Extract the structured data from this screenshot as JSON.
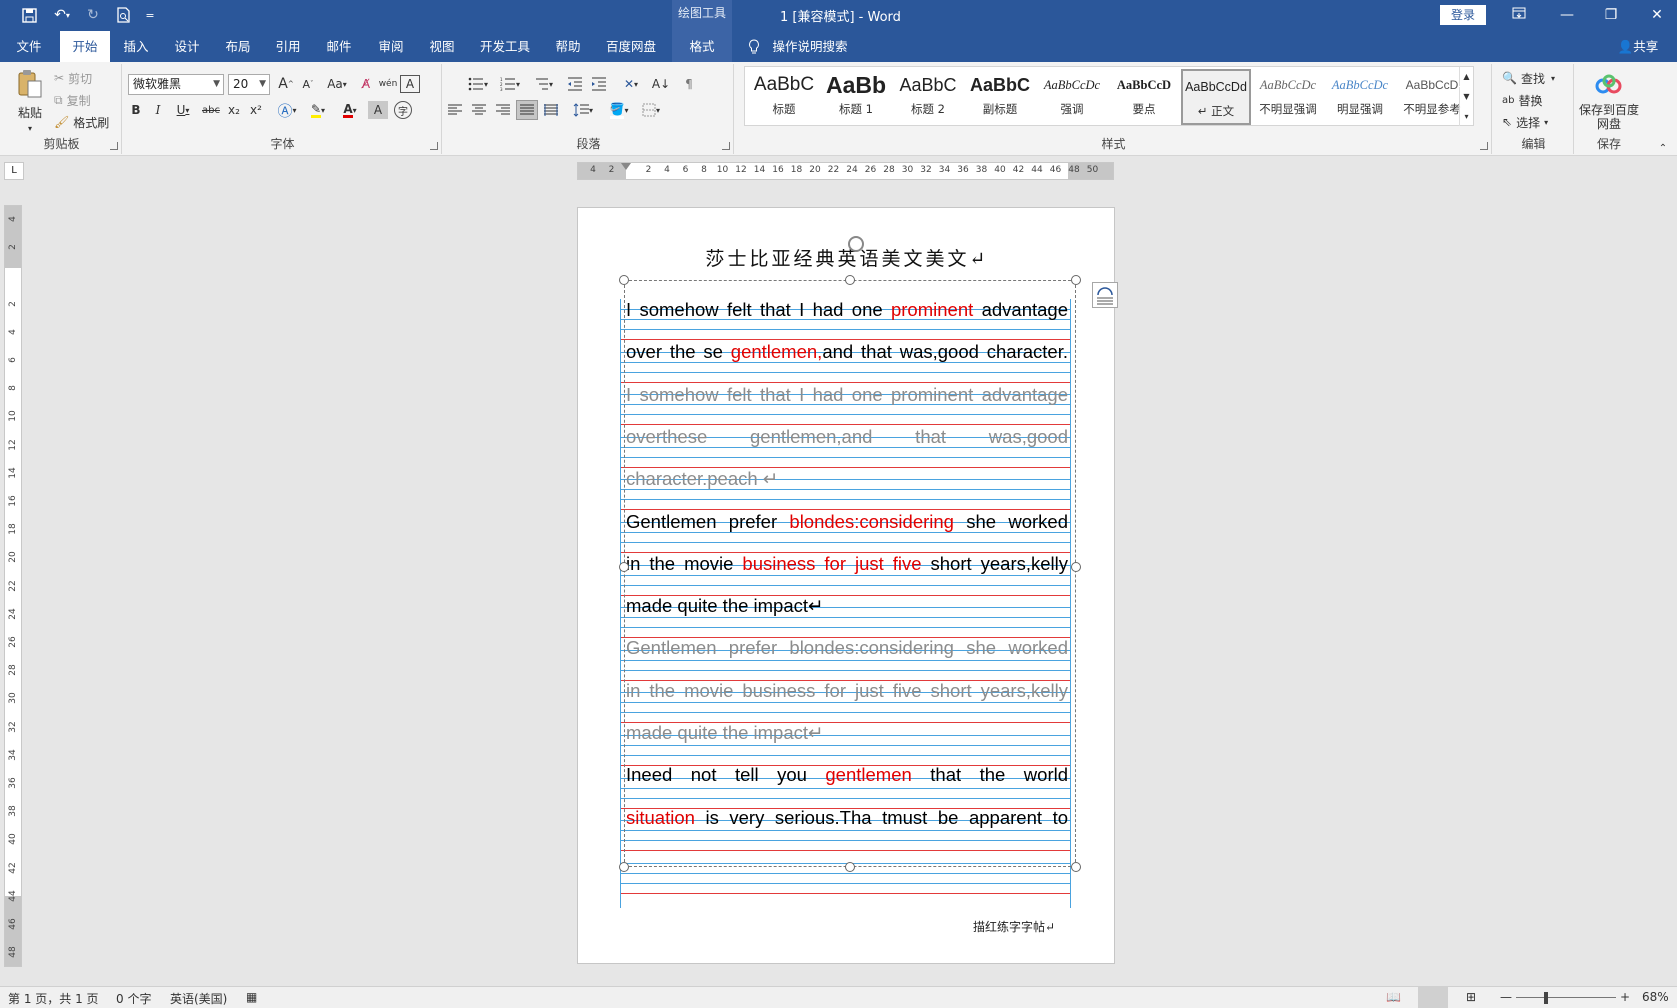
{
  "titlebar": {
    "title": "1 [兼容模式] - Word",
    "context_group": "绘图工具",
    "login": "登录",
    "qat_more": "="
  },
  "tabs": [
    {
      "label": "文件"
    },
    {
      "label": "开始"
    },
    {
      "label": "插入"
    },
    {
      "label": "设计"
    },
    {
      "label": "布局"
    },
    {
      "label": "引用"
    },
    {
      "label": "邮件"
    },
    {
      "label": "审阅"
    },
    {
      "label": "视图"
    },
    {
      "label": "开发工具"
    },
    {
      "label": "帮助"
    },
    {
      "label": "百度网盘"
    },
    {
      "label": "格式"
    }
  ],
  "tell_me": "操作说明搜索",
  "share": "共享",
  "ribbon": {
    "clipboard": {
      "label": "剪贴板",
      "paste": "粘贴",
      "cut": "剪切",
      "copy": "复制",
      "format_painter": "格式刷"
    },
    "font": {
      "label": "字体",
      "name": "微软雅黑",
      "size": "20",
      "grow": "A",
      "shrink": "A",
      "case": "Aa",
      "bold": "B",
      "italic": "I",
      "underline": "U",
      "strike": "abc",
      "sub": "x₂",
      "sup": "x²",
      "phonetic": "wén",
      "char_border": "A",
      "font_color": "A",
      "char_shading": "A",
      "enclose": "字"
    },
    "paragraph": {
      "label": "段落"
    },
    "styles": {
      "label": "样式",
      "items": [
        {
          "preview": "AaBbC",
          "name": "标题"
        },
        {
          "preview": "AaBb",
          "name": "标题 1"
        },
        {
          "preview": "AaBbC",
          "name": "标题 2"
        },
        {
          "preview": "AaBbC",
          "name": "副标题"
        },
        {
          "preview": "AaBbCcDc",
          "name": "强调"
        },
        {
          "preview": "AaBbCcD",
          "name": "要点"
        },
        {
          "preview": "AaBbCcDd",
          "name": "正文"
        },
        {
          "preview": "AaBbCcDc",
          "name": "不明显强调"
        },
        {
          "preview": "AaBbCcDc",
          "name": "明显强调"
        },
        {
          "preview": "AaBbCcD",
          "name": "不明显参考"
        }
      ]
    },
    "editing": {
      "label": "编辑",
      "find": "查找",
      "replace": "替换",
      "select": "选择"
    },
    "save": {
      "label": "保存",
      "button": "保存到百度网盘"
    }
  },
  "ruler": {
    "h": [
      "4",
      "2",
      "",
      "2",
      "4",
      "6",
      "8",
      "10",
      "12",
      "14",
      "16",
      "18",
      "20",
      "22",
      "24",
      "26",
      "28",
      "30",
      "32",
      "34",
      "36",
      "38",
      "40",
      "42",
      "44",
      "46",
      "48",
      "50"
    ],
    "v": [
      "4",
      "2",
      "",
      "2",
      "4",
      "6",
      "8",
      "10",
      "12",
      "14",
      "16",
      "18",
      "20",
      "22",
      "24",
      "26",
      "28",
      "30",
      "32",
      "34",
      "36",
      "38",
      "40",
      "42",
      "44",
      "46",
      "48"
    ]
  },
  "document": {
    "title": "莎士比亚经典英语美文美文↵",
    "paragraphs": [
      {
        "trace": false,
        "parts": [
          {
            "t": "I somehow felt that I had one ",
            "red": false
          },
          {
            "t": "prominent",
            "red": true
          },
          {
            "t": " advantage",
            "red": false
          }
        ]
      },
      {
        "trace": false,
        "parts": [
          {
            "t": "over the se ",
            "red": false
          },
          {
            "t": "gentlemen,",
            "red": true
          },
          {
            "t": "and that was,good character.",
            "red": false
          }
        ]
      },
      {
        "trace": true,
        "parts": [
          {
            "t": "I somehow felt that I had one prominent advantage",
            "red": false
          }
        ]
      },
      {
        "trace": true,
        "parts": [
          {
            "t": "overthese gentlemen,and that was,good",
            "red": false
          }
        ]
      },
      {
        "trace": true,
        "short": true,
        "parts": [
          {
            "t": "character.peach ↵",
            "red": false
          }
        ]
      },
      {
        "trace": false,
        "parts": [
          {
            "t": "Gentlemen prefer ",
            "red": false
          },
          {
            "t": "blondes:considering",
            "red": true
          },
          {
            "t": " she worked",
            "red": false
          }
        ]
      },
      {
        "trace": false,
        "parts": [
          {
            "t": "in the movie ",
            "red": false
          },
          {
            "t": "business for just five",
            "red": true
          },
          {
            "t": " short years,kelly",
            "red": false
          }
        ]
      },
      {
        "trace": false,
        "short": true,
        "parts": [
          {
            "t": "made quite the impact↵",
            "red": false
          }
        ]
      },
      {
        "trace": true,
        "parts": [
          {
            "t": "Gentlemen prefer blondes:considering she worked",
            "red": false
          }
        ]
      },
      {
        "trace": true,
        "parts": [
          {
            "t": "in the movie business for just five short years,kelly",
            "red": false
          }
        ]
      },
      {
        "trace": true,
        "short": true,
        "parts": [
          {
            "t": "made quite the impact↵",
            "red": false
          }
        ]
      },
      {
        "trace": false,
        "parts": [
          {
            "t": "Ineed not tell you ",
            "red": false
          },
          {
            "t": "gentlemen",
            "red": true
          },
          {
            "t": " that the world",
            "red": false
          }
        ]
      },
      {
        "trace": false,
        "parts": [
          {
            "t": "situation",
            "red": true
          },
          {
            "t": " is very serious.Tha tmust be apparent to",
            "red": false
          }
        ]
      }
    ],
    "footer": "描红练字字帖↵"
  },
  "status": {
    "page": "第 1 页，共 1 页",
    "words": "0 个字",
    "lang": "英语(美国)",
    "zoom": "68%"
  },
  "colors": {
    "accent": "#2b579a",
    "red": "#e00000",
    "blueline": "#4aa3df",
    "redline": "#e23a3a"
  }
}
